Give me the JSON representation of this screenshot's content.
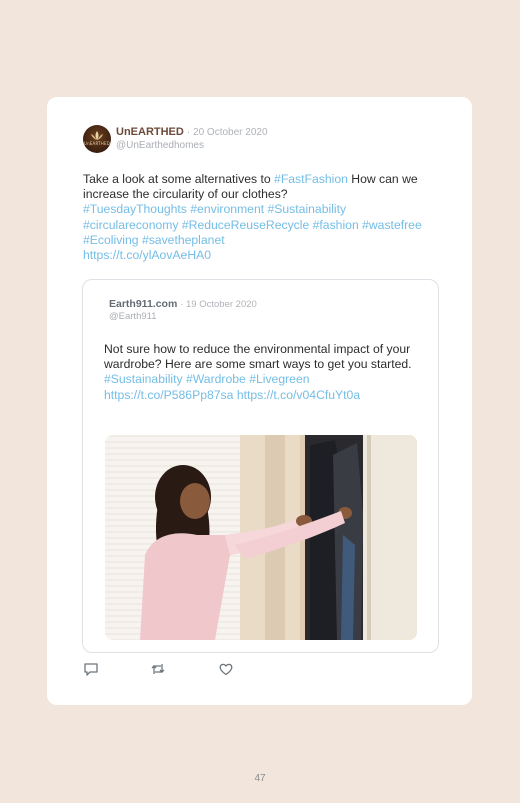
{
  "colors": {
    "page_bg": "#f2e6dc",
    "card_bg": "#ffffff",
    "link": "#74bde6",
    "name": "#6b4a3a"
  },
  "tweet": {
    "author": "UnEARTHED",
    "date": "· 20 October 2020",
    "handle": "@UnEarthedhomes",
    "avatar_text": "UnEARTHED",
    "text_1": "Take a look at some alternatives to ",
    "tag_fastfashion": "#FastFashion",
    "text_2": " How can we increase the circularity of our clothes?",
    "hashtags_line": "#TuesdayThoughts #environment #Sustainability #circulareconomy #ReduceReuseRecycle #fashion #wastefree #Ecoliving #savetheplanet",
    "link": "https://t.co/ylAovAeHA0"
  },
  "quote": {
    "author": "Earth911.com",
    "date": "· 19 October 2020",
    "handle": "@Earth911",
    "text": "Not sure how to reduce the environmental impact of your wardrobe? Here are some smart ways to get you started.",
    "hashtags": "#Sustainability #Wardrobe #Livegreen",
    "link_1": "https://t.co/P586Pp87sa",
    "link_2": "https://t.co/v04CfuYt0a"
  },
  "actions": {
    "reply_icon": "reply-icon",
    "retweet_icon": "retweet-icon",
    "like_icon": "heart-icon"
  },
  "page_number": "47"
}
